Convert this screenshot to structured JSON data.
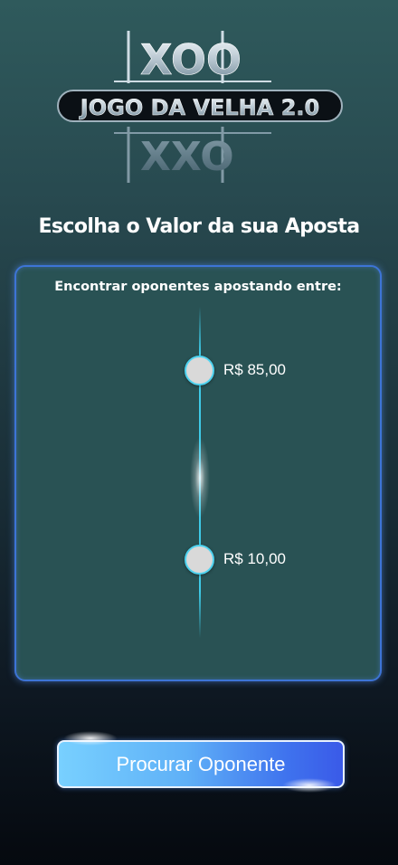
{
  "logo": {
    "top_row": "XOO",
    "title": "JOGO DA VELHA 2.0",
    "bottom_row": "XXO"
  },
  "page": {
    "title": "Escolha o Valor da sua Aposta"
  },
  "range": {
    "label": "Encontrar oponentes apostando entre:",
    "max_value": "R$ 85,00",
    "min_value": "R$ 10,00"
  },
  "actions": {
    "search_label": "Procurar Oponente"
  },
  "colors": {
    "accent_blue": "#3d74d6",
    "track_cyan": "#3ecbe8",
    "panel_bg": "#295254"
  }
}
